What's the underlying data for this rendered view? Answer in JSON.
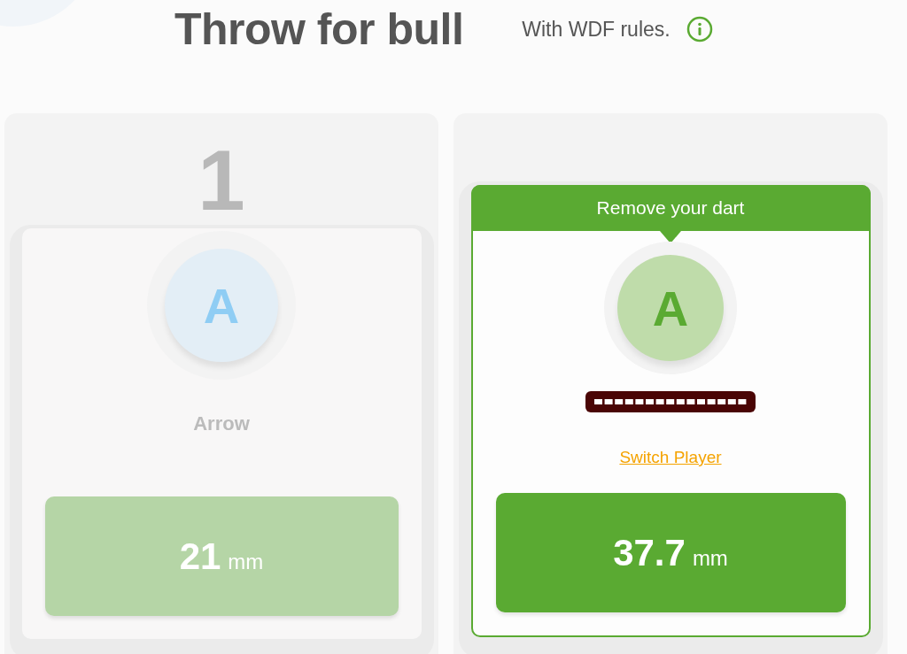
{
  "header": {
    "title": "Throw for bull",
    "subtitle": "With WDF rules."
  },
  "players": [
    {
      "number": "1",
      "initial": "A",
      "name": "Arrow",
      "active": false,
      "distance": "21",
      "unit": "mm"
    },
    {
      "initial": "A",
      "name_hidden": true,
      "banner": "Remove your dart",
      "link": "Switch Player",
      "active": true,
      "distance": "37.7",
      "unit": "mm"
    }
  ]
}
